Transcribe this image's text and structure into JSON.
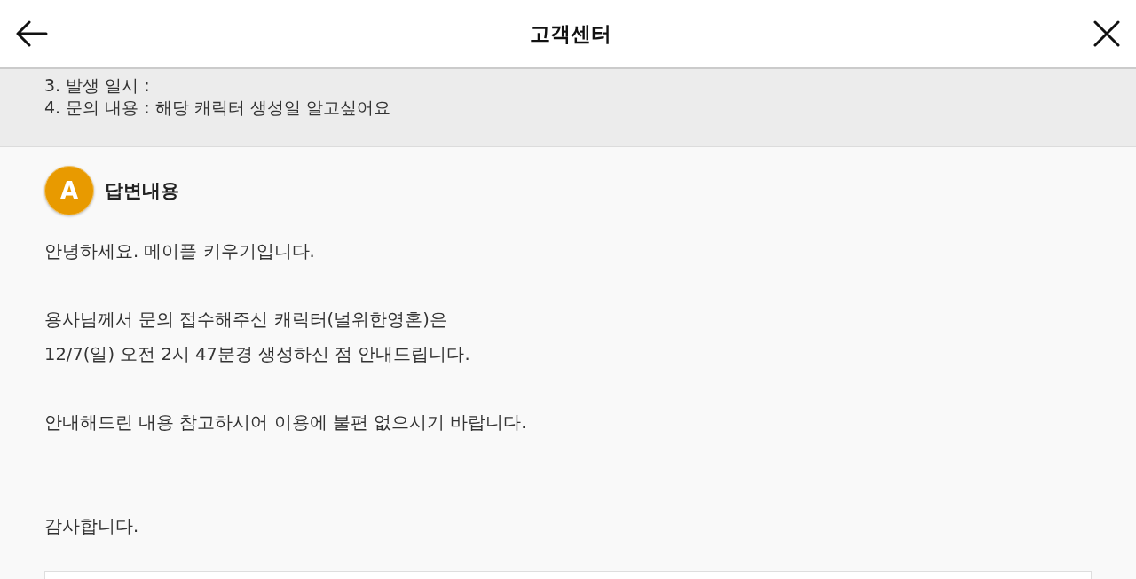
{
  "header": {
    "title": "고객센터"
  },
  "question": {
    "lines": [
      "3. 발생 일시 :",
      "4. 문의 내용 : 해당 캐릭터 생성일 알고싶어요"
    ]
  },
  "answer": {
    "badge": "A",
    "heading": "답변내용",
    "paragraphs": [
      [
        "안녕하세요. 메이플 키우기입니다."
      ],
      [
        "용사님께서 문의 접수해주신 캐릭터(널위한영혼)은",
        "12/7(일) 오전 2시 47분경 생성하신 점 안내드립니다."
      ],
      [
        "안내해드린 내용 참고하시어 이용에 불편 없으시기 바랍니다."
      ]
    ],
    "closing": "감사합니다."
  }
}
